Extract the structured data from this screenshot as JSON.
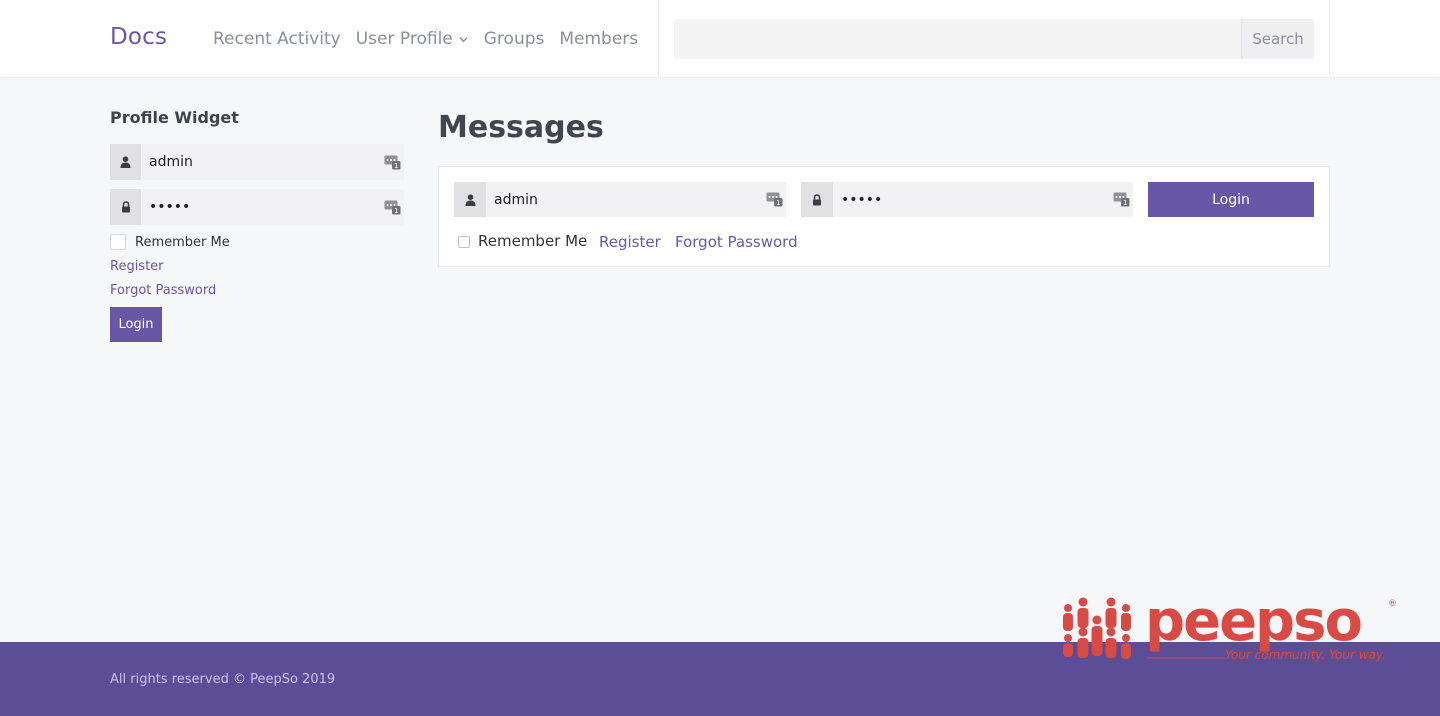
{
  "header": {
    "brand": "Docs",
    "nav": [
      {
        "label": "Recent Activity"
      },
      {
        "label": "User Profile"
      },
      {
        "label": "Groups"
      },
      {
        "label": "Members"
      }
    ],
    "search": {
      "value": "",
      "button_label": "Search"
    }
  },
  "sidebar": {
    "title": "Profile Widget",
    "username_value": "admin",
    "password_value": "•••••",
    "remember_label": "Remember Me",
    "register_label": "Register",
    "forgot_label": "Forgot Password",
    "login_label": "Login"
  },
  "main": {
    "title": "Messages",
    "username_value": "admin",
    "password_value": "•••••",
    "login_label": "Login",
    "remember_label": "Remember Me",
    "register_label": "Register",
    "forgot_label": "Forgot Password"
  },
  "footer": {
    "copyright": "All rights reserved © PeepSo 2019",
    "logo_text": "peepso",
    "logo_tagline": "Your community. Your way."
  },
  "colors": {
    "accent": "#6856a6",
    "footer_bg": "#5b4d96",
    "page_bg": "#f6f7f9",
    "logo_red": "#d94a45",
    "logo_pink": "#e6a3a6"
  }
}
